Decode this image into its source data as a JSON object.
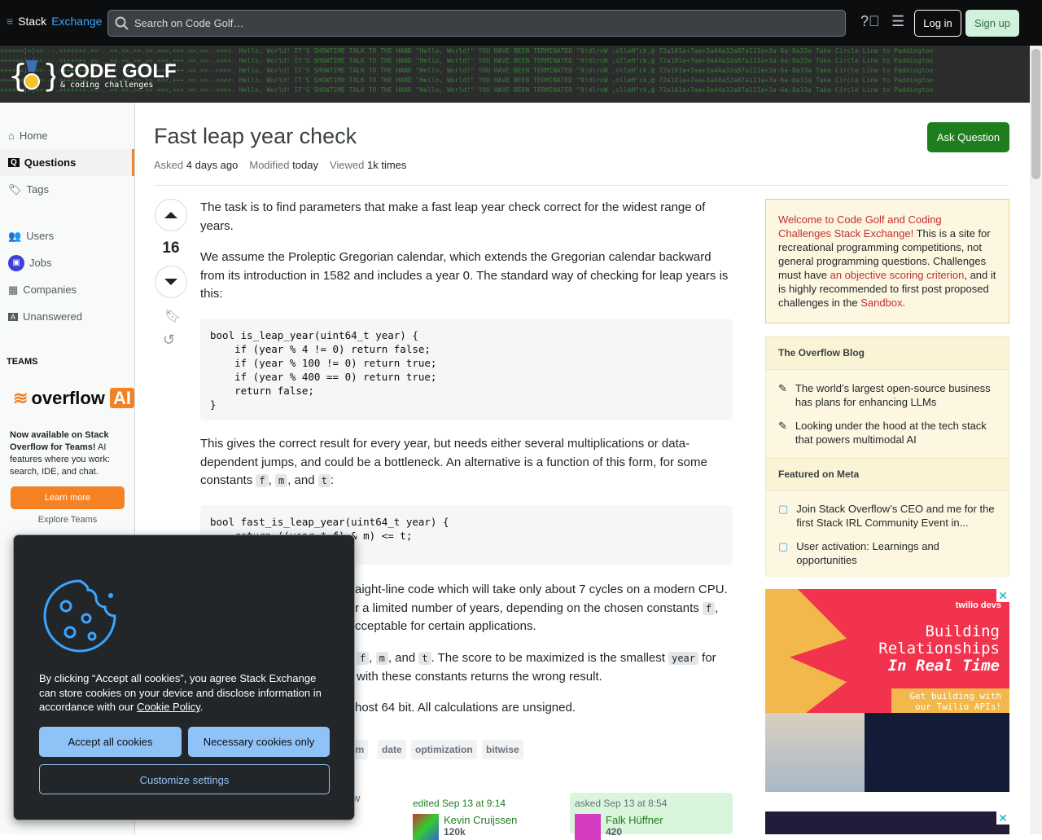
{
  "topbar": {
    "brand_a": "Stack",
    "brand_b": "Exchange",
    "search_placeholder": "Search on Code Golf…",
    "login": "Log in",
    "signup": "Sign up"
  },
  "site": {
    "title": "CODE GOLF",
    "subtitle": "& coding challenges",
    "banner_code": "+>+<<<]>]<<---.<++++++.<<-..<<.<<.>>.>>.<<<,+++.>>.>>-.<<<<. Hello, World! IT'S SHOWTIME TALK TO THE HAND \"Hello, World!\" YOU HAVE BEEN TERMINATED \"9!dlroW ,olleH\"ck,@ 72a101a+7aa+3a44a32a87a111a+3a-6a-8a33a Take Circle Line to Paddington"
  },
  "sidebar": {
    "items": [
      {
        "label": "Home",
        "icon": "home-icon"
      },
      {
        "label": "Questions",
        "icon": "questions-icon"
      },
      {
        "label": "Tags",
        "icon": "tag-icon"
      },
      {
        "label": "Users",
        "icon": "users-icon"
      },
      {
        "label": "Jobs",
        "icon": "briefcase-icon"
      },
      {
        "label": "Companies",
        "icon": "companies-icon"
      },
      {
        "label": "Unanswered",
        "icon": "unanswered-icon"
      }
    ],
    "teams_heading": "TEAMS",
    "teams_logo": "overflow",
    "teams_logo_ai": "AI",
    "teams_bold": "Now available on Stack Overflow for Teams!",
    "teams_text": " AI features where you work: search, IDE, and chat.",
    "learn_more": "Learn more",
    "explore": "Explore Teams"
  },
  "question": {
    "title": "Fast leap year check",
    "asked_label": "Asked",
    "asked": "4 days ago",
    "modified_label": "Modified",
    "modified": "today",
    "viewed_label": "Viewed",
    "viewed": "1k times",
    "score": "16",
    "ask_button": "Ask Question",
    "p1": "The task is to find parameters that make a fast leap year check correct for the widest range of years.",
    "p2": "We assume the Proleptic Gregorian calendar, which extends the Gregorian calendar backward from its introduction in 1582 and includes a year 0. The standard way of checking for leap years is this:",
    "code1": "bool is_leap_year(uint64_t year) {\n    if (year % 4 != 0) return false;\n    if (year % 100 != 0) return true;\n    if (year % 400 == 0) return true;\n    return false;\n}",
    "p3a": "This gives the correct result for every year, but needs either several multiplications or data-dependent jumps, and could be a bottleneck. An alternative is a function of this form, for some constants ",
    "c_f": "f",
    "c_m": "m",
    "c_t": "t",
    "and": ", and ",
    "colon": ":",
    "comma": ", ",
    "code2": "bool fast_is_leap_year(uint64_t year) {\n    return ((year * f) & m) <= t;",
    "p4a": "aight-line code which will take only about 7 cycles on a modern CPU.",
    "p4b": "r a limited number of years, depending on the chosen constants ",
    "p4c": "cceptable for certain applications.",
    "p5b": ". The score to be maximized is the smallest ",
    "c_year": "year",
    "p5c": " for",
    "p5d": "with these constants returns the wrong result.",
    "p6": "host 64 bit. All calculations are unsigned.",
    "tags": [
      "em",
      "date",
      "optimization",
      "bitwise"
    ],
    "share_partial": "llow",
    "edited": "edited Sep 13 at 9:14",
    "editor": "Kevin Cruijssen",
    "editor_rep": "120k",
    "asked_full": "asked Sep 13 at 8:54",
    "author": "Falk Hüffner",
    "author_rep": "420"
  },
  "welcome": {
    "link": "Welcome to Code Golf and Coding Challenges Stack Exchange!",
    "t1": " This is a site for recreational programming competitions, not general programming questions. Challenges must have ",
    "link2": "an objective scoring criterion",
    "t2": ", and it is highly recommended to first post proposed challenges in the ",
    "link3": "Sandbox",
    "t3": "."
  },
  "blog": {
    "heading": "The Overflow Blog",
    "items": [
      "The world’s largest open-source business has plans for enhancing LLMs",
      "Looking under the hood at the tech stack that powers multimodal AI"
    ],
    "meta_heading": "Featured on Meta",
    "meta_items": [
      "Join Stack Overflow’s CEO and me for the first Stack IRL Community Event in...",
      "User activation: Learnings and opportunities"
    ]
  },
  "ad": {
    "brand": "twilio devs",
    "l1": "Building",
    "l2": "Relationships",
    "l3": "In Real Time",
    "cta1": "Get building with",
    "cta2": "our Twilio APIs!",
    "close": "✕"
  },
  "cookie": {
    "text": "By clicking “Accept all cookies”, you agree Stack Exchange can store cookies on your device and disclose information in accordance with our ",
    "link": "Cookie Policy",
    "end": ".",
    "accept": "Accept all cookies",
    "necessary": "Necessary cookies only",
    "customize": "Customize settings"
  }
}
